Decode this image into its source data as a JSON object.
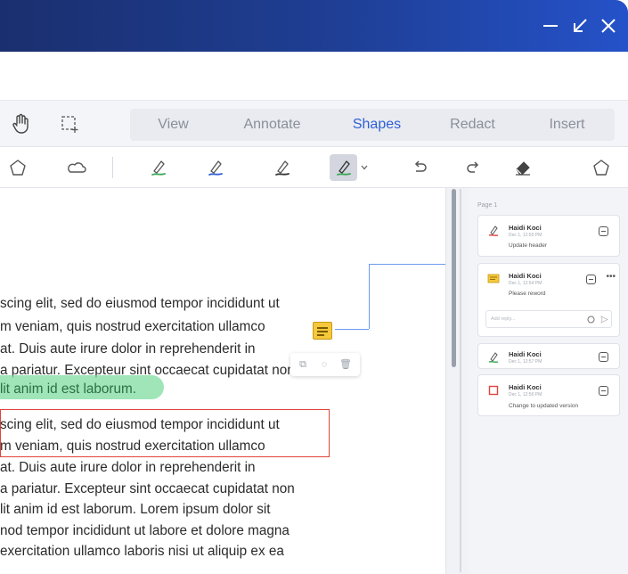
{
  "window": {
    "controls": [
      "minimize-icon",
      "restore-icon",
      "close-icon"
    ]
  },
  "tabs": [
    {
      "label": "View",
      "active": false
    },
    {
      "label": "Annotate",
      "active": false
    },
    {
      "label": "Shapes",
      "active": true
    },
    {
      "label": "Redact",
      "active": false
    },
    {
      "label": "Insert",
      "active": false
    }
  ],
  "toolbar_row1": {
    "icons": [
      "pan-hand-icon",
      "marquee-select-icon"
    ]
  },
  "toolbar_row2": {
    "icons": [
      "pentagon-shape-icon",
      "cloud-shape-icon",
      "pen-green-icon",
      "pen-blue-icon",
      "pen-black-icon",
      "pen-dropdown-icon",
      "undo-icon",
      "redo-icon",
      "eraser-icon",
      "polygon-icon"
    ],
    "colors": {
      "green": "#3aa757",
      "blue": "#2f5fd6",
      "black": "#333333",
      "accent": "#2f5fd6"
    }
  },
  "document": {
    "lines_block1": [
      "scing elit, sed do eiusmod tempor incididunt ut",
      "m veniam, quis nostrud exercitation ullamco",
      "at. Duis aute irure dolor in reprehenderit in",
      "a pariatur. Excepteur sint occaecat cupidatat non",
      "lit anim id est laborum."
    ],
    "lines_block2": [
      "scing elit, sed do eiusmod tempor incididunt ut",
      "m veniam, quis nostrud exercitation ullamco",
      "at. Duis aute irure dolor in reprehenderit in",
      "a pariatur. Excepteur sint occaecat cupidatat non",
      "lit anim id est laborum. Lorem ipsum dolor sit",
      "nod tempor incididunt ut labore et dolore magna",
      "exercitation ullamco laboris nisi ut aliquip ex ea"
    ],
    "highlight_color": "#7fdca0",
    "redbox_color": "#e0443c"
  },
  "comments_panel": {
    "page_label": "Page 1",
    "comments": [
      {
        "author": "Haidi Koci",
        "date": "Dec 1, 12:55 PM",
        "message": "Update header",
        "icon": "pen-red-icon"
      },
      {
        "author": "Haidi Koci",
        "date": "Dec 1, 12:54 PM",
        "message": "Please reword",
        "icon": "note-icon"
      },
      {
        "author": "Haidi Koci",
        "date": "Dec 1, 12:57 PM",
        "message": "",
        "icon": "pen-green-icon"
      },
      {
        "author": "Haidi Koci",
        "date": "Dec 1, 12:56 PM",
        "message": "Change to updated version",
        "icon": "rectangle-red-icon"
      }
    ],
    "reply_placeholder": "Add reply..."
  }
}
